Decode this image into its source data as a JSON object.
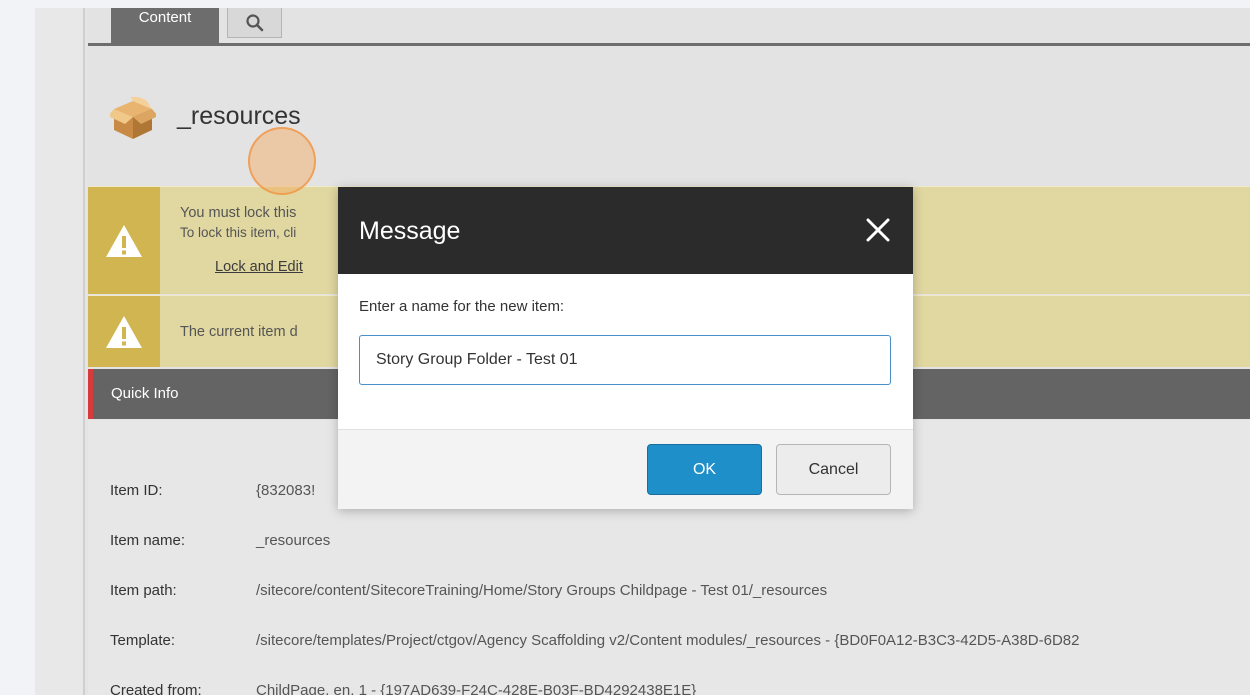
{
  "tabs": {
    "content_label": "Content",
    "search_icon": "search-icon"
  },
  "item": {
    "title": "_resources",
    "icon": "package-box-icon"
  },
  "warnings": [
    {
      "line1": "You must lock this",
      "line2": "To lock this item, cli",
      "link": "Lock and Edit"
    },
    {
      "line1": "The current item d"
    }
  ],
  "quick_info": {
    "title": "Quick Info",
    "rows": [
      {
        "label": "Item ID:",
        "value": "{832083!"
      },
      {
        "label": "Item name:",
        "value": "_resources"
      },
      {
        "label": "Item path:",
        "value": "/sitecore/content/SitecoreTraining/Home/Story Groups Childpage - Test 01/_resources"
      },
      {
        "label": "Template:",
        "value": "/sitecore/templates/Project/ctgov/Agency Scaffolding v2/Content modules/_resources - {BD0F0A12-B3C3-42D5-A38D-6D82"
      },
      {
        "label": "Created from:",
        "value": "ChildPage, en, 1 - {197AD639-F24C-428E-B03F-BD4292438E1E}"
      }
    ]
  },
  "dialog": {
    "title": "Message",
    "prompt": "Enter a name for the new item:",
    "input_value": "Story Group Folder - Test 01",
    "ok_label": "OK",
    "cancel_label": "Cancel"
  },
  "colors": {
    "warning_bg": "#e0d7a1",
    "warning_icon_bg": "#d1b551",
    "dialog_header": "#2b2b2b",
    "ok_button": "#1f8fc9",
    "quick_info_bar": "#646464",
    "quick_info_accent": "#d63b3b"
  }
}
